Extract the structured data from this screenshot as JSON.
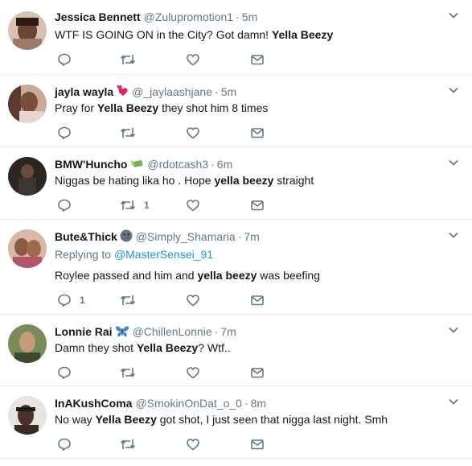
{
  "tweets": [
    {
      "name": "Jessica Bennett",
      "emoji": "",
      "handle": "@Zulupromotion1",
      "time": "5m",
      "replying_label": "",
      "replying_to": "",
      "text_before": "WTF IS GOING ON in the City?  Got damn! ",
      "text_bold": "Yella Beezy",
      "text_after": "",
      "reply_count": "",
      "retweet_count": "",
      "like_count": ""
    },
    {
      "name": "jayla wayla",
      "emoji": "hearts-emoji",
      "handle": "@_jaylaashjane",
      "time": "5m",
      "replying_label": "",
      "replying_to": "",
      "text_before": "Pray for ",
      "text_bold": "Yella Beezy",
      "text_after": " they shot him 8 times",
      "reply_count": "",
      "retweet_count": "",
      "like_count": ""
    },
    {
      "name": "BMW'Huncho",
      "emoji": "money-wings-emoji",
      "handle": "@rdotcash3",
      "time": "6m",
      "replying_label": "",
      "replying_to": "",
      "text_before": "Niggas be hating lika ho . Hope ",
      "text_bold": "yella beezy",
      "text_after": " straight",
      "reply_count": "",
      "retweet_count": "1",
      "like_count": ""
    },
    {
      "name": "Bute&Thick",
      "emoji": "moon-face-emoji",
      "handle": "@Simply_Shamaria",
      "time": "7m",
      "replying_label": "Replying to",
      "replying_to": "@MasterSensei_91",
      "text_before": "Roylee passed and him and ",
      "text_bold": "yella beezy",
      "text_after": " was beefing",
      "reply_count": "1",
      "retweet_count": "",
      "like_count": ""
    },
    {
      "name": "Lonnie Rai",
      "emoji": "butterfly-emoji",
      "handle": "@ChillenLonnie",
      "time": "7m",
      "replying_label": "",
      "replying_to": "",
      "text_before": "Damn they shot ",
      "text_bold": "Yella Beezy",
      "text_after": "? Wtf..",
      "reply_count": "",
      "retweet_count": "",
      "like_count": ""
    },
    {
      "name": "InAKushComa",
      "emoji": "",
      "handle": "@SmokinOnDat_o_0",
      "time": "8m",
      "replying_label": "",
      "replying_to": "",
      "text_before": "No way ",
      "text_bold": "Yella Beezy",
      "text_after": " got shot, I just seen that nigga last night. Smh",
      "reply_count": "",
      "retweet_count": "",
      "like_count": ""
    }
  ],
  "colors": {
    "icon_gray": "#657786",
    "link_blue": "#1b95e0",
    "divider": "#e6ecf0"
  }
}
